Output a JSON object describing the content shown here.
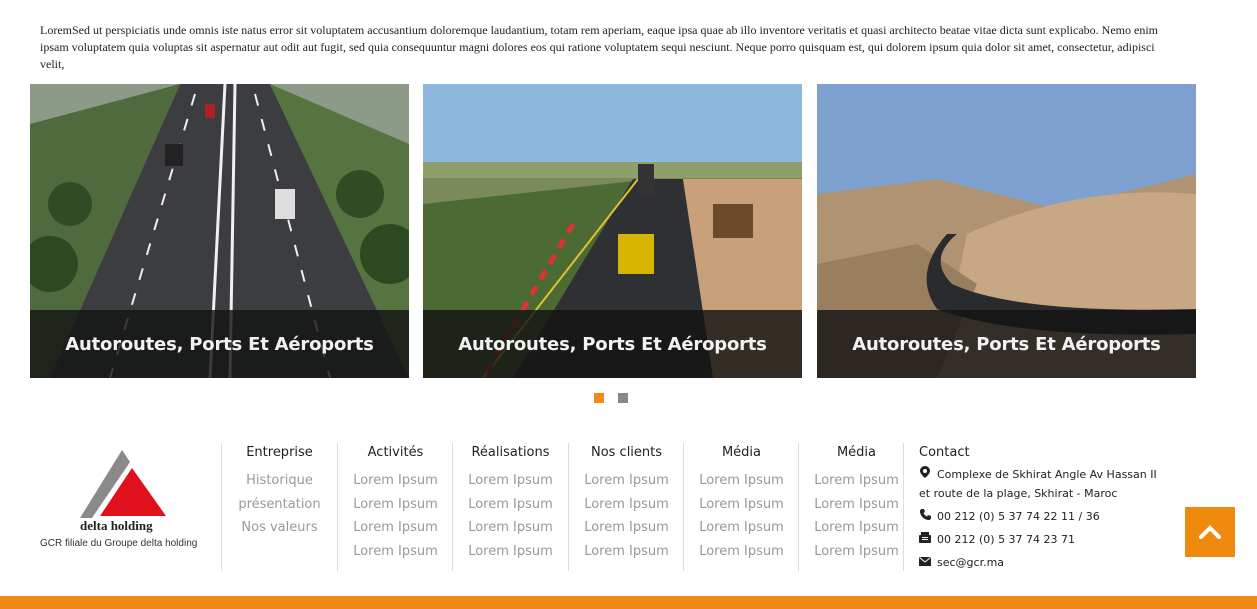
{
  "intro": {
    "text": "LoremSed ut perspiciatis unde omnis iste natus error sit voluptatem accusantium doloremque laudantium, totam rem aperiam, eaque ipsa quae ab illo inventore veritatis et quasi architecto beatae vitae dicta sunt explicabo. Nemo enim ipsam voluptatem quia voluptas sit aspernatur aut odit aut fugit, sed quia consequuntur magni dolores eos qui ratione voluptatem sequi nesciunt. Neque porro quisquam est, qui dolorem ipsum quia dolor sit amet, consectetur, adipisci velit,"
  },
  "carousel": {
    "cards": [
      {
        "caption": "Autoroutes, Ports Et Aéroports"
      },
      {
        "caption": "Autoroutes, Ports Et Aéroports"
      },
      {
        "caption": "Autoroutes, Ports Et Aéroports"
      }
    ],
    "active_dot": 0,
    "dot_colors": {
      "active": "#ee8a16",
      "inactive": "#888888"
    }
  },
  "footer": {
    "logo": {
      "brand": "delta holding",
      "tagline": "GCR filiale du Groupe delta holding"
    },
    "columns": [
      {
        "title": "Entreprise",
        "items": [
          "Historique",
          "présentation",
          "Nos valeurs"
        ]
      },
      {
        "title": "Activités",
        "items": [
          "Lorem Ipsum",
          "Lorem Ipsum",
          "Lorem Ipsum",
          "Lorem Ipsum"
        ]
      },
      {
        "title": "Réalisations",
        "items": [
          "Lorem Ipsum",
          "Lorem Ipsum",
          "Lorem Ipsum",
          "Lorem Ipsum"
        ]
      },
      {
        "title": "Nos clients",
        "items": [
          "Lorem Ipsum",
          "Lorem Ipsum",
          "Lorem Ipsum",
          "Lorem Ipsum"
        ]
      },
      {
        "title": "Média",
        "items": [
          "Lorem Ipsum",
          "Lorem Ipsum",
          "Lorem Ipsum",
          "Lorem Ipsum"
        ]
      },
      {
        "title": "Média",
        "items": [
          "Lorem Ipsum",
          "Lorem Ipsum",
          "Lorem Ipsum",
          "Lorem Ipsum"
        ]
      }
    ],
    "contact": {
      "title": "Contact",
      "address_line1": "Complexe de Skhirat Angle Av Hassan II",
      "address_line2": "et route de la plage, Skhirat - Maroc",
      "phone": "00 212 (0) 5 37 74 22 11 / 36",
      "fax": "00 212 (0) 5 37 74 23 71",
      "email": "sec@gcr.ma"
    }
  },
  "colors": {
    "accent": "#ee8a16",
    "logo_red": "#e0101c",
    "logo_gray": "#8a8a8a"
  }
}
